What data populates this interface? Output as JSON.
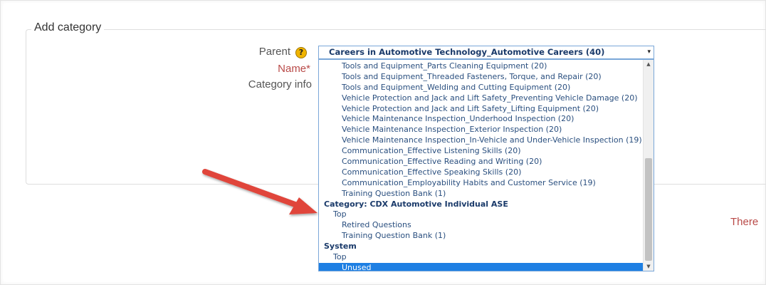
{
  "form": {
    "legend": "Add category",
    "parent_label": "Parent",
    "name_label": "Name*",
    "info_label": "Category info",
    "help_icon": "help-icon"
  },
  "select": {
    "selected": "Careers in Automotive Technology_Automotive Careers (40)",
    "arrow_glyph": "▾"
  },
  "options": [
    {
      "text": "Tools and Equipment_Parts Cleaning Equipment (20)",
      "level": "l2"
    },
    {
      "text": "Tools and Equipment_Threaded Fasteners, Torque, and Repair (20)",
      "level": "l2"
    },
    {
      "text": "Tools and Equipment_Welding and Cutting Equipment (20)",
      "level": "l2"
    },
    {
      "text": "Vehicle Protection and Jack and Lift Safety_Preventing Vehicle Damage (20)",
      "level": "l2"
    },
    {
      "text": "Vehicle Protection and Jack and Lift Safety_Lifting Equipment (20)",
      "level": "l2"
    },
    {
      "text": "Vehicle Maintenance Inspection_Underhood Inspection (20)",
      "level": "l2"
    },
    {
      "text": "Vehicle Maintenance Inspection_Exterior Inspection (20)",
      "level": "l2"
    },
    {
      "text": "Vehicle Maintenance Inspection_In-Vehicle and Under-Vehicle Inspection (19)",
      "level": "l2"
    },
    {
      "text": "Communication_Effective Listening Skills (20)",
      "level": "l2"
    },
    {
      "text": "Communication_Effective Reading and Writing (20)",
      "level": "l2"
    },
    {
      "text": "Communication_Effective Speaking Skills (20)",
      "level": "l2"
    },
    {
      "text": "Communication_Employability Habits and Customer Service (19)",
      "level": "l2"
    },
    {
      "text": "Training Question Bank (1)",
      "level": "l2"
    },
    {
      "text": "Category: CDX Automotive Individual ASE",
      "level": "grp"
    },
    {
      "text": "Top",
      "level": "l1"
    },
    {
      "text": "Retired Questions",
      "level": "l2"
    },
    {
      "text": "Training Question Bank (1)",
      "level": "l2"
    },
    {
      "text": "System",
      "level": "grp"
    },
    {
      "text": "Top",
      "level": "l1"
    },
    {
      "text": "Unused",
      "level": "l2",
      "selected": true
    }
  ],
  "side_text": "There",
  "colors": {
    "required_red": "#b94a48",
    "highlight_blue": "#1e7fe3",
    "annotation_arrow": "#e0453a"
  }
}
